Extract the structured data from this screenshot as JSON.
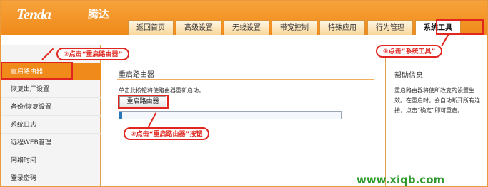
{
  "brand": {
    "logo": "Tenda",
    "logo_cn": "腾达"
  },
  "tabs": [
    {
      "label": "返回首页"
    },
    {
      "label": "高级设置"
    },
    {
      "label": "无线设置"
    },
    {
      "label": "带宽控制"
    },
    {
      "label": "特殊应用"
    },
    {
      "label": "行为管理"
    },
    {
      "label": "系统工具",
      "active": true
    }
  ],
  "sidebar": {
    "items": [
      {
        "label": "重启路由器",
        "active": true
      },
      {
        "label": "恢复出厂设置"
      },
      {
        "label": "备份/恢复设置"
      },
      {
        "label": "系统日志"
      },
      {
        "label": "远程WEB管理"
      },
      {
        "label": "网络时间"
      },
      {
        "label": "登录密码"
      }
    ]
  },
  "main": {
    "title": "重启路由器",
    "description": "单击此按钮将使路由器重新启动。",
    "reboot_button_label": "重启路由器",
    "progress_fraction": 0.01
  },
  "help": {
    "title": "帮助信息",
    "text": "重启路由器将使所改变的设置生效。在重启时，会自动断开所有连接，点击“确定”即可重启。"
  },
  "annotations": {
    "step1": "①点击“系统工具”",
    "step2": "②点击“重启路由器”",
    "step3": "③点击“重启路由器”按钮",
    "accent_color": "#e0261f"
  },
  "watermark": "www.xiqb.com"
}
